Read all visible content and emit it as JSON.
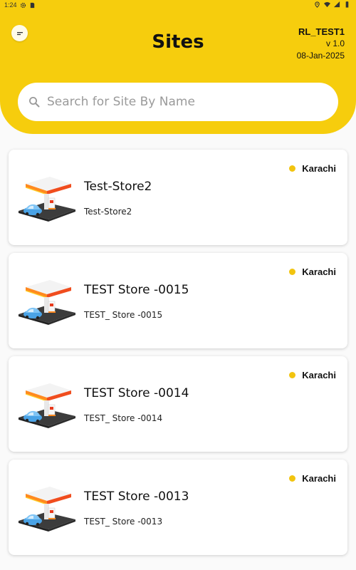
{
  "status_bar": {
    "time": "1:24",
    "icons": [
      "settings-icon",
      "sim-card-icon",
      "location-icon",
      "wifi-icon",
      "signal-icon",
      "battery-icon"
    ]
  },
  "header": {
    "title": "Sites",
    "user": "RL_TEST1",
    "version": "v 1.0",
    "date": "08-Jan-2025",
    "menu_icon": "menu-icon",
    "accent_color": "#f6cd0d"
  },
  "search": {
    "placeholder": "Search for Site By Name",
    "value": ""
  },
  "sites": [
    {
      "name": "Test-Store2",
      "subtitle": "Test-Store2",
      "city": "Karachi",
      "icon": "fuel-station-icon"
    },
    {
      "name": "TEST Store -0015",
      "subtitle": "TEST_ Store -0015",
      "city": "Karachi",
      "icon": "fuel-station-icon"
    },
    {
      "name": "TEST Store -0014",
      "subtitle": "TEST_ Store -0014",
      "city": "Karachi",
      "icon": "fuel-station-icon"
    },
    {
      "name": "TEST Store -0013",
      "subtitle": "TEST_ Store -0013",
      "city": "Karachi",
      "icon": "fuel-station-icon"
    }
  ]
}
